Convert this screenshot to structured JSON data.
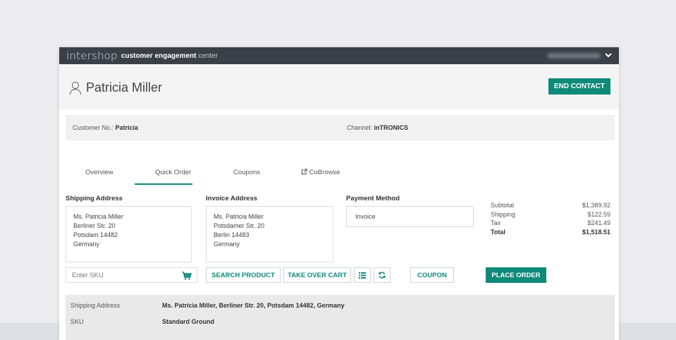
{
  "app": {
    "brand": "intershop",
    "product_bold": "customer engagement",
    "product_rest": "center",
    "user_menu_chevron": "⌄"
  },
  "customer": {
    "name": "Patricia Miller",
    "number_label": "Customer No.:",
    "number": "Patricia",
    "channel_label": "Channel:",
    "channel": "inTRONICS"
  },
  "actions": {
    "end_contact": "END CONTACT"
  },
  "tabs": [
    {
      "label": "Overview",
      "active": false
    },
    {
      "label": "Quick Order",
      "active": true
    },
    {
      "label": "Coupons",
      "active": false
    },
    {
      "label": "CoBrowse",
      "active": false
    }
  ],
  "shipping": {
    "title": "Shipping Address",
    "lines": [
      "Ms. Patricia Miller",
      "Berliner Str. 20",
      "Potsdam 14482",
      "Germany"
    ]
  },
  "invoice": {
    "title": "Invoice Address",
    "lines": [
      "Ms. Patricia Miller",
      "Potsdamer Str. 20",
      "Berlin 14483",
      "Germany"
    ]
  },
  "payment": {
    "title": "Payment Method",
    "value": "Invoice"
  },
  "totals": [
    {
      "label": "Subtotal",
      "value": "$1,389.92"
    },
    {
      "label": "Shipping",
      "value": "$122.59"
    },
    {
      "label": "Tax",
      "value": "$241.49"
    },
    {
      "label": "Total",
      "value": "$1,518.51"
    }
  ],
  "order_bar": {
    "sku_placeholder": "Enter SKU",
    "search_product": "SEARCH PRODUCT",
    "take_over_cart": "TAKE OVER CART",
    "coupon": "COUPON",
    "place_order": "PLACE ORDER"
  },
  "summary": [
    {
      "label": "Shipping Address",
      "value": "Ms. Patricia Miller, Berliner Str. 20, Potsdam 14482, Germany"
    },
    {
      "label": "SKU",
      "value": "Standard Ground"
    }
  ],
  "colors": {
    "accent": "#0d8a78",
    "topbar": "#3b3f46"
  }
}
